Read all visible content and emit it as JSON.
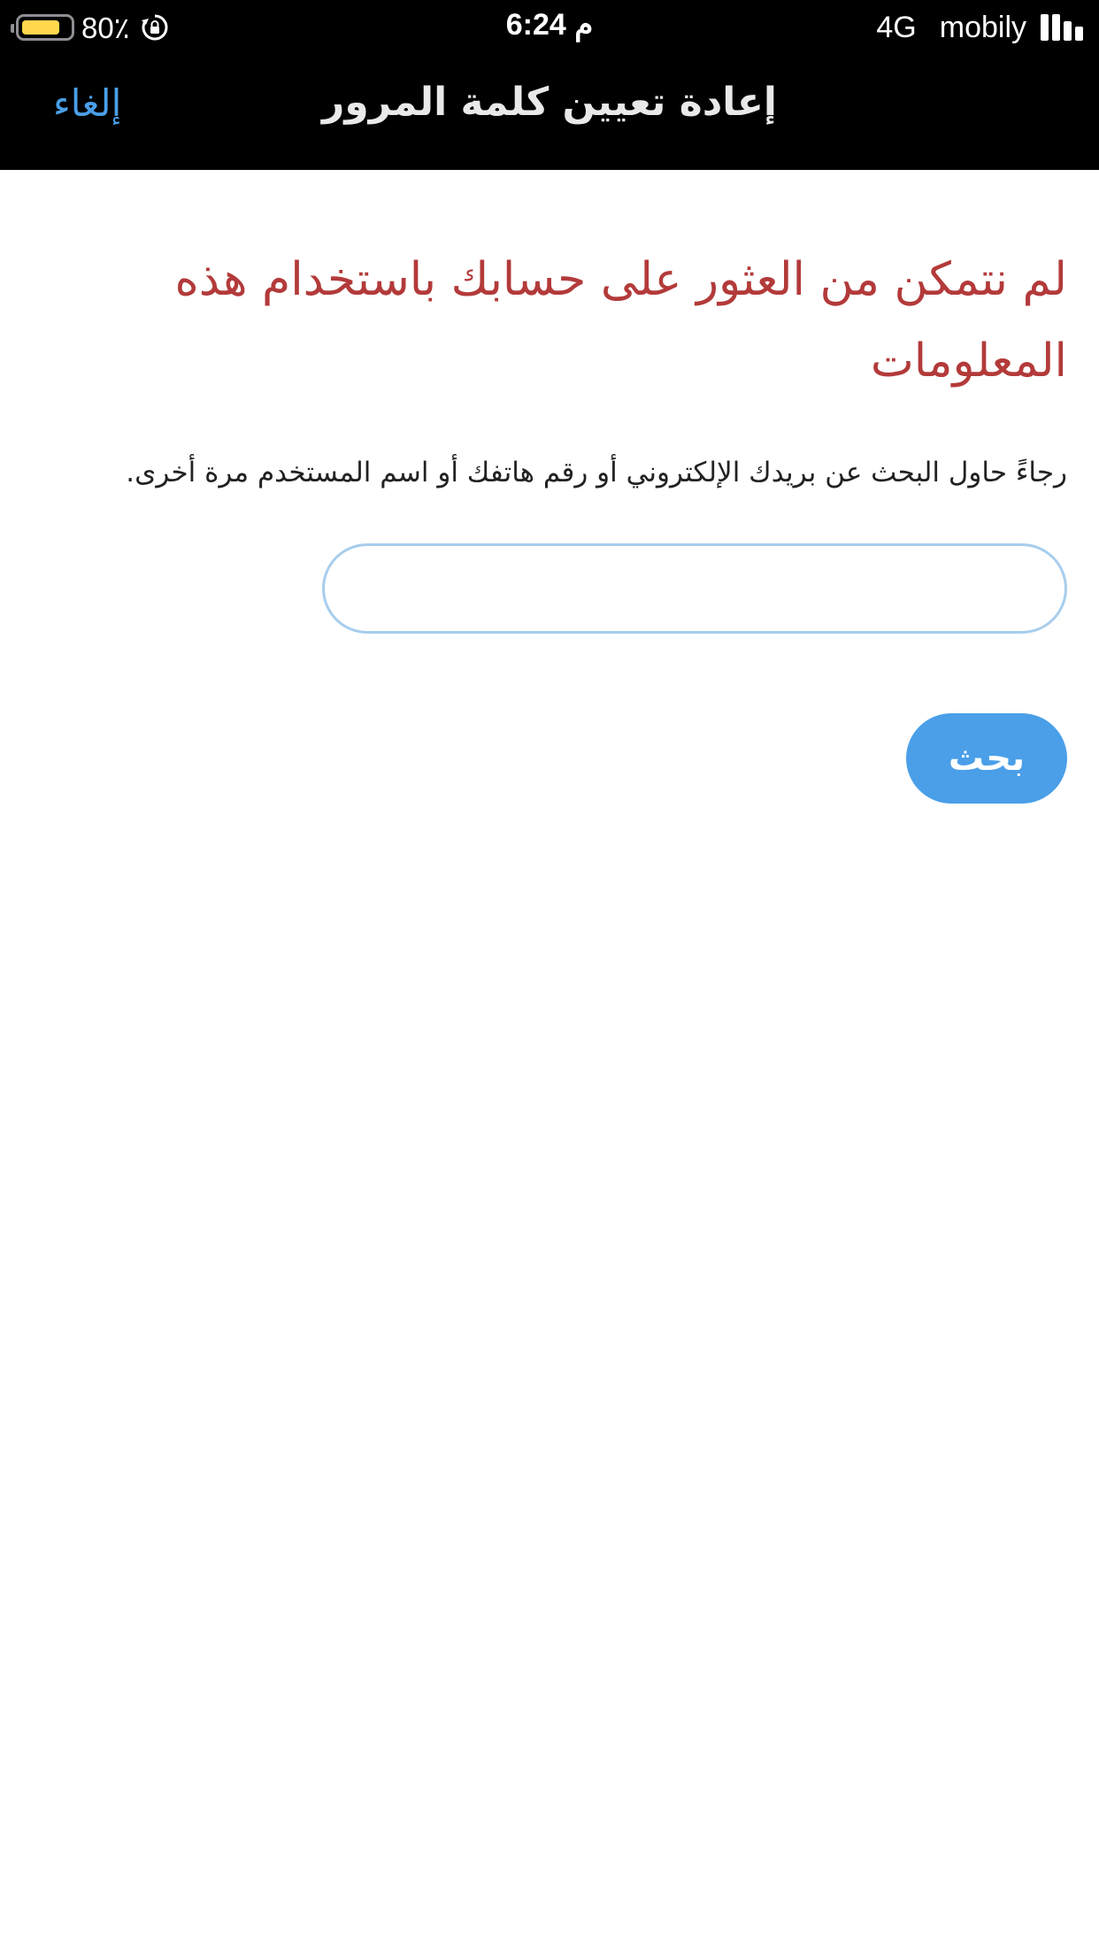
{
  "status_bar": {
    "battery_percent_text": "80٪",
    "battery_level": 0.8,
    "battery_color": "#ffd84d",
    "rotation_lock_icon": "rotation-lock-icon",
    "time": "6:24 م",
    "network_type": "4G",
    "carrier": "mobily",
    "signal_icon": "signal-bars-icon"
  },
  "nav": {
    "title": "إعادة تعيين كلمة المرور",
    "cancel_label": "إلغاء"
  },
  "main": {
    "error_heading": "لم نتمكن من العثور على حسابك باستخدام هذه المعلومات",
    "help_text": "رجاءً حاول البحث عن بريدك الإلكتروني أو رقم هاتفك أو اسم المستخدم مرة أخرى.",
    "search_input_value": "",
    "search_input_placeholder": "",
    "search_button_label": "بحث"
  },
  "colors": {
    "accent": "#4a9fe8",
    "error": "#b33a3a",
    "input_border": "#a7cdec",
    "bar_background": "#000000"
  }
}
